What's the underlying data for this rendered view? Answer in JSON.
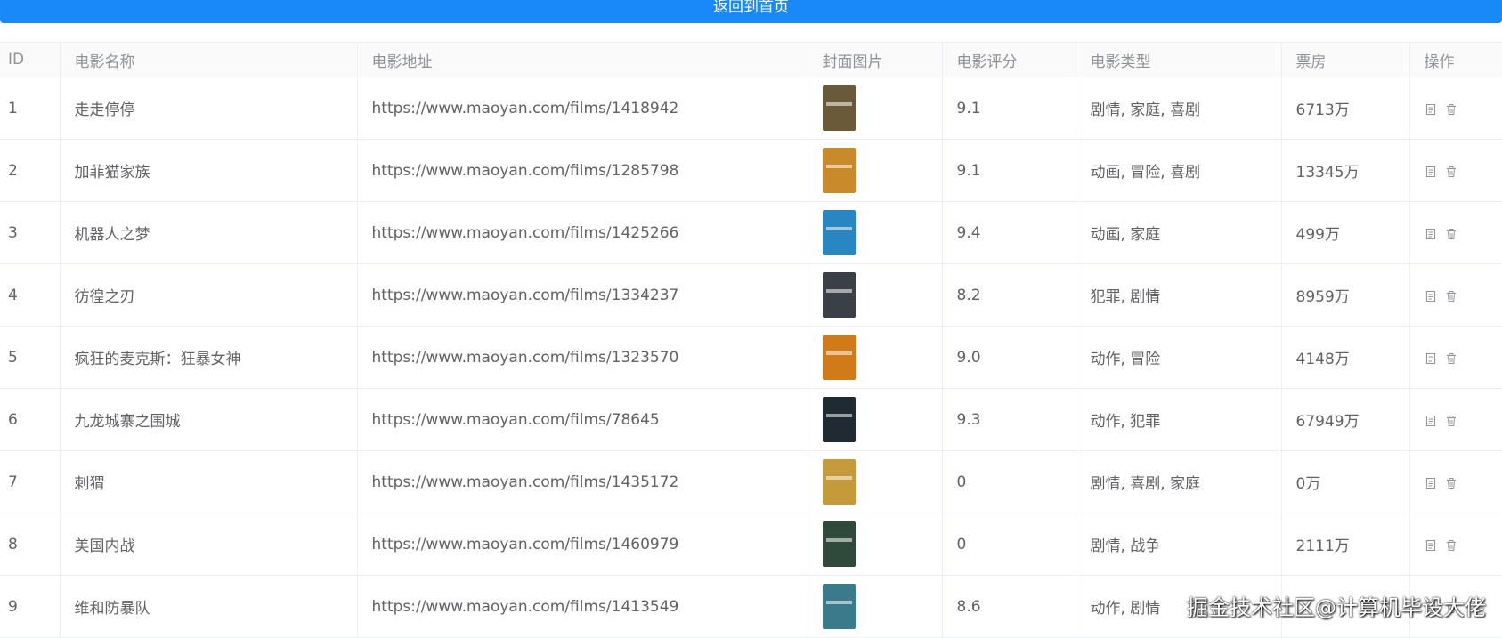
{
  "topbar": {
    "label": "返回到首页",
    "color": "#1989fa"
  },
  "table": {
    "headers": [
      "ID",
      "电影名称",
      "电影地址",
      "封面图片",
      "电影评分",
      "电影类型",
      "票房",
      "操作"
    ],
    "rows": [
      {
        "id": "1",
        "name": "走走停停",
        "url": "https://www.maoyan.com/films/1418942",
        "poster_color": "#6b5a3a",
        "rating": "9.1",
        "genre": "剧情, 家庭, 喜剧",
        "box_office": "6713万"
      },
      {
        "id": "2",
        "name": "加菲猫家族",
        "url": "https://www.maoyan.com/films/1285798",
        "poster_color": "#c98a2a",
        "rating": "9.1",
        "genre": "动画, 冒险, 喜剧",
        "box_office": "13345万"
      },
      {
        "id": "3",
        "name": "机器人之梦",
        "url": "https://www.maoyan.com/films/1425266",
        "poster_color": "#2a86c2",
        "rating": "9.4",
        "genre": "动画, 家庭",
        "box_office": "499万"
      },
      {
        "id": "4",
        "name": "彷徨之刃",
        "url": "https://www.maoyan.com/films/1334237",
        "poster_color": "#3a3f48",
        "rating": "8.2",
        "genre": "犯罪, 剧情",
        "box_office": "8959万"
      },
      {
        "id": "5",
        "name": "疯狂的麦克斯：狂暴女神",
        "url": "https://www.maoyan.com/films/1323570",
        "poster_color": "#d07a1a",
        "rating": "9.0",
        "genre": "动作, 冒险",
        "box_office": "4148万"
      },
      {
        "id": "6",
        "name": "九龙城寨之围城",
        "url": "https://www.maoyan.com/films/78645",
        "poster_color": "#1f2a33",
        "rating": "9.3",
        "genre": "动作, 犯罪",
        "box_office": "67949万"
      },
      {
        "id": "7",
        "name": "刺猬",
        "url": "https://www.maoyan.com/films/1435172",
        "poster_color": "#c49a3a",
        "rating": "0",
        "genre": "剧情, 喜剧, 家庭",
        "box_office": "0万"
      },
      {
        "id": "8",
        "name": "美国内战",
        "url": "https://www.maoyan.com/films/1460979",
        "poster_color": "#2f4a3a",
        "rating": "0",
        "genre": "剧情, 战争",
        "box_office": "2111万"
      },
      {
        "id": "9",
        "name": "维和防暴队",
        "url": "https://www.maoyan.com/films/1413549",
        "poster_color": "#3a7a8a",
        "rating": "8.6",
        "genre": "动作, 剧情",
        "box_office": ""
      }
    ]
  },
  "icons": {
    "edit": "edit-icon",
    "delete": "delete-icon"
  },
  "watermark": "掘金技术社区@计算机毕设大佬"
}
